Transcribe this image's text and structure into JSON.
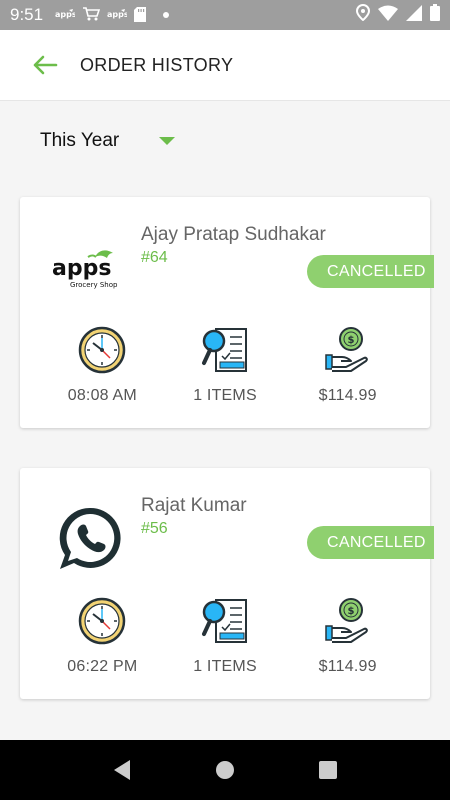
{
  "status_bar": {
    "time": "9:51",
    "left_icons": [
      "apps-notification-icon",
      "cart-notification-icon",
      "apps-notification-icon",
      "sd-card-icon",
      "dot-icon"
    ],
    "right_icons": [
      "location-icon",
      "wifi-icon",
      "signal-icon",
      "battery-icon"
    ]
  },
  "header": {
    "title": "ORDER HISTORY",
    "accent": "#6cbd4a"
  },
  "filter": {
    "selected": "This Year"
  },
  "orders": [
    {
      "customer": "Ajay Pratap Sudhakar",
      "number": "#64",
      "status": "CANCELLED",
      "logo": "apps-grocery-shop-logo",
      "logo_wordmark": "apps",
      "logo_subtitle": "Grocery Shop",
      "time": "08:08 AM",
      "items": "1 ITEMS",
      "total": "$114.99"
    },
    {
      "customer": "Rajat Kumar",
      "number": "#56",
      "status": "CANCELLED",
      "logo": "whatsapp-logo",
      "time": "06:22 PM",
      "items": "1 ITEMS",
      "total": "$114.99"
    }
  ],
  "colors": {
    "accent": "#6cbd4a",
    "status_pill": "#8fd06f",
    "status_bar": "#9e9e9e"
  }
}
